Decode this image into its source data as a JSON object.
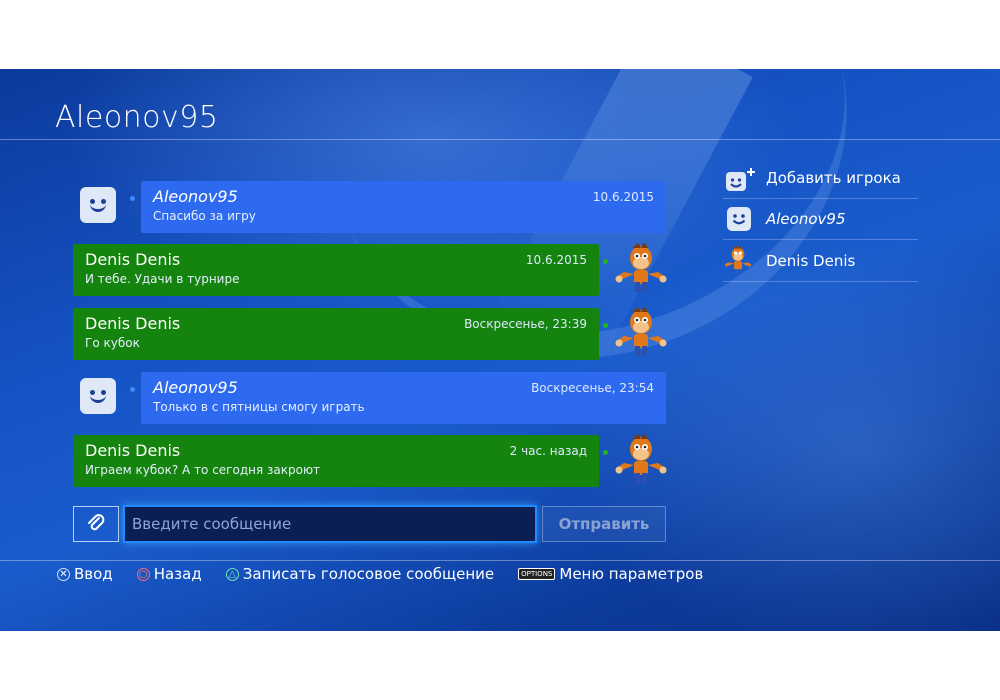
{
  "header": {
    "title": "Aleonov95"
  },
  "messages": [
    {
      "sender": "Aleonov95",
      "date": "10.6.2015",
      "text": "Спасибо за игру",
      "kind": "self"
    },
    {
      "sender": "Denis Denis",
      "date": "10.6.2015",
      "text": "И тебе. Удачи в турнире",
      "kind": "other"
    },
    {
      "sender": "Denis Denis",
      "date": "Воскресенье, 23:39",
      "text": "Го кубок",
      "kind": "other"
    },
    {
      "sender": "Aleonov95",
      "date": "Воскресенье, 23:54",
      "text": "Только в с пятницы смогу играть",
      "kind": "self"
    },
    {
      "sender": "Denis Denis",
      "date": "2 час. назад",
      "text": "Играем кубок? А то сегодня закроют",
      "kind": "other"
    }
  ],
  "composer": {
    "placeholder": "Введите сообщение",
    "send_label": "Отправить"
  },
  "sidebar": {
    "add_player": "Добавить игрока",
    "members": [
      "Aleonov95",
      "Denis Denis"
    ]
  },
  "hints": {
    "enter": "Ввод",
    "back": "Назад",
    "voice": "Записать голосовое сообщение",
    "options_key": "OPTIONS",
    "options": "Меню параметров"
  },
  "colors": {
    "self_bubble": "#2d6af0",
    "other_bubble": "#15840e",
    "input_glow": "#1e8bff"
  },
  "icons": {
    "self_avatar": "smiley-avatar-icon",
    "other_avatar": "crash-bandicoot-avatar",
    "attach": "paperclip-icon",
    "add_player": "add-player-icon"
  }
}
